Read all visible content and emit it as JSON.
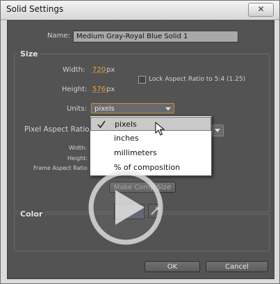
{
  "window": {
    "title": "Solid Settings",
    "close_label": "✕"
  },
  "name_row": {
    "label": "Name:",
    "value": "Medium Gray-Royal Blue Solid 1"
  },
  "size": {
    "title": "Size",
    "width_label": "Width:",
    "width_value": "720",
    "width_unit": "px",
    "height_label": "Height:",
    "height_value": "576",
    "height_unit": "px",
    "lock_label": "Lock Aspect Ratio to 5:4 (1.25)",
    "units_label": "Units:",
    "units_value": "pixels",
    "par_label": "Pixel Aspect Ratio:",
    "info_width_label": "Width:",
    "info_height_label": "Height:",
    "info_frame_label": "Frame Aspect Ratio",
    "make_comp_size": "Make Comp Size"
  },
  "units_menu": {
    "options": [
      "pixels",
      "inches",
      "millimeters",
      "% of composition"
    ],
    "selected": "pixels"
  },
  "color": {
    "title": "Color",
    "swatch": "#5c6472",
    "eyedropper_icon": "eyedropper-icon"
  },
  "buttons": {
    "ok": "OK",
    "cancel": "Cancel"
  },
  "overlay": {
    "icon": "play-icon"
  }
}
